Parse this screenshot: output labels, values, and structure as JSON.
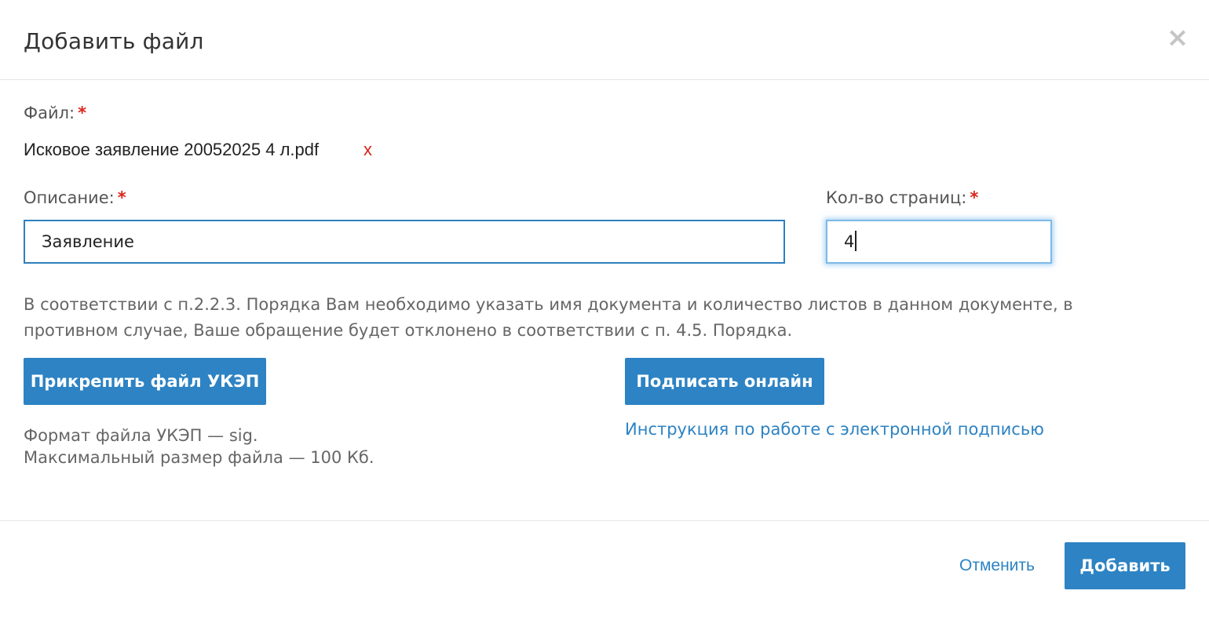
{
  "dialog": {
    "title": "Добавить файл",
    "close_symbol": "×"
  },
  "file": {
    "label": "Файл:",
    "required_mark": "*",
    "name": "Исковое заявление 20052025 4 л.pdf",
    "remove_symbol": "x"
  },
  "description": {
    "label": "Описание:",
    "required_mark": "*",
    "value": "Заявление"
  },
  "pages": {
    "label": "Кол-во страниц:",
    "required_mark": "*",
    "value": "4"
  },
  "notice": "В соответствии с п.2.2.3. Порядка Вам необходимо указать имя документа и количество листов в данном документе, в противном случае, Ваше обращение будет отклонено в соответствии с п. 4.5. Порядка.",
  "attach_button": "Прикрепить файл УКЭП",
  "sign_button": "Подписать онлайн",
  "hint": {
    "format": "Формат файла УКЭП — sig.",
    "max_size": "Максимальный размер файла — 100 Кб."
  },
  "instruction_link": "Инструкция по работе с электронной подписью",
  "footer": {
    "cancel": "Отменить",
    "add": "Добавить"
  },
  "colors": {
    "primary": "#2d83c3",
    "required": "#d9251c"
  }
}
